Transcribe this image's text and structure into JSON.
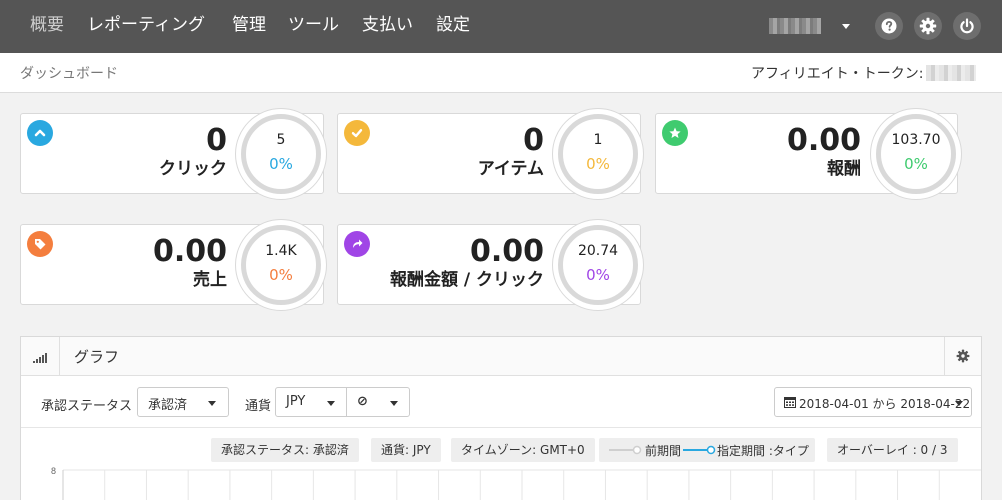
{
  "nav": {
    "items": [
      "概要",
      "レポーティング",
      "管理",
      "ツール",
      "支払い",
      "設定"
    ]
  },
  "subheader": {
    "breadcrumb": "ダッシュボード",
    "token_label": "アフィリエイト・トークン:"
  },
  "cards": [
    {
      "value": "0",
      "label": "クリック",
      "gauge_top": "5",
      "gauge_pct": "0%",
      "color": "#29a8e0",
      "icon": "chevron-up-icon"
    },
    {
      "value": "0",
      "label": "アイテム",
      "gauge_top": "1",
      "gauge_pct": "0%",
      "color": "#f4b83b",
      "icon": "check-icon"
    },
    {
      "value": "0.00",
      "label": "報酬",
      "gauge_top": "103.70",
      "gauge_pct": "0%",
      "color": "#3fcb6f",
      "icon": "star-icon"
    },
    {
      "value": "0.00",
      "label": "売上",
      "gauge_top": "1.4K",
      "gauge_pct": "0%",
      "color": "#f47e3e",
      "icon": "tag-icon"
    },
    {
      "value": "0.00",
      "label": "報酬金額 / クリック",
      "gauge_top": "20.74",
      "gauge_pct": "0%",
      "color": "#a045e6",
      "icon": "share-icon"
    }
  ],
  "graph": {
    "title": "グラフ",
    "status_label": "承認ステータス",
    "status_value": "承認済",
    "currency_label": "通貨",
    "currency_value": "JPY",
    "extra_value": "⊘",
    "date_range": "2018-04-01 から 2018-04-22",
    "chips": {
      "status": "承認ステータス: 承認済",
      "currency": "通貨: JPY",
      "timezone": "タイムゾーン: GMT+0",
      "previous_period": "前期間",
      "current_period": "指定期間 :タイプ",
      "overlay": "オーバーレイ : 0 / 3"
    }
  },
  "chart_data": {
    "type": "line",
    "y_tick_top": "8",
    "series": []
  }
}
